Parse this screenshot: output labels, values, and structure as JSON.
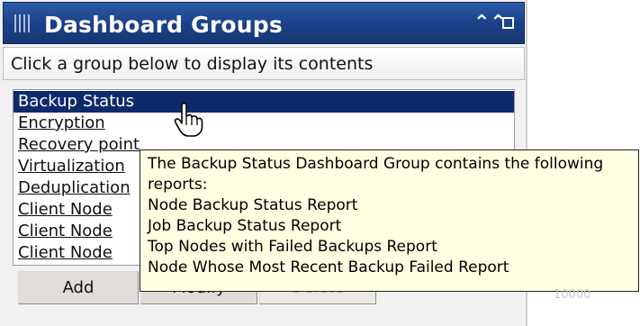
{
  "panel": {
    "title": "Dashboard Groups",
    "instruction": "Click a group below to display its contents"
  },
  "groups": [
    {
      "label": "Backup Status",
      "selected": true
    },
    {
      "label": "Encryption"
    },
    {
      "label": "Recovery point"
    },
    {
      "label": "Virtualization"
    },
    {
      "label": "Deduplication"
    },
    {
      "label": "Client Node"
    },
    {
      "label": "Client Node"
    },
    {
      "label": "Client Node"
    }
  ],
  "buttons": {
    "add": "Add",
    "modify": "Modify",
    "delete": "Delete"
  },
  "tooltip": {
    "lines": [
      "The Backup Status Dashboard Group contains the following",
      "reports:",
      "Node Backup Status Report",
      "Job Backup Status Report",
      "Top Nodes with Failed Backups Report",
      "Node Whose Most Recent Backup Failed Report"
    ]
  },
  "background": {
    "fragment": "10000"
  },
  "colors": {
    "titlebar": "#1b4088",
    "selection": "#0d2a6c",
    "tooltip_bg": "#ffffe1"
  },
  "icons": {
    "title_grip": "grip-icon",
    "collapse": "double-chevron-up-icon",
    "maximize": "maximize-icon",
    "cursor": "hand-pointer-icon"
  }
}
